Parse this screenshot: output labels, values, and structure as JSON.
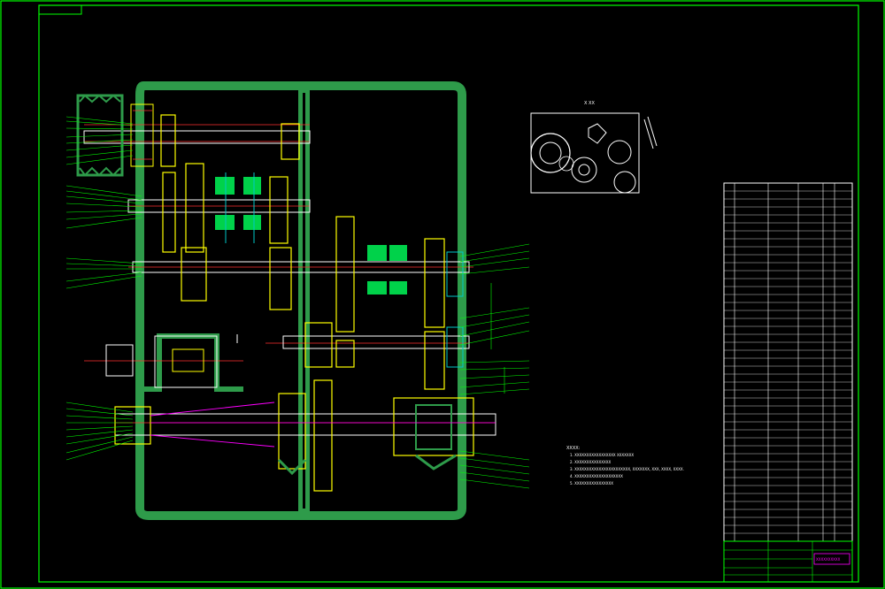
{
  "drawing": {
    "view_label": "X  XX",
    "notes_title": "XXXX:",
    "notes": [
      "1. XXXXXXXXXXXXXXXXX XXXXXXX",
      "2. XXXXXXXXXXXXXXX",
      "3. XXXXXXXXXXXXXXXXXXXXXXX, XXXXXXX, XXX, XXXX, XXXX.",
      "4. XXXXXXXXXXXXXXXXXXXX",
      "5. XXXXXXXXXXXXXXXX"
    ],
    "title_block_name": "XXXXXXXXXX"
  },
  "colors": {
    "background": "#000000",
    "frame": "#00ff00",
    "housing": "#2e9b4a",
    "gear_yellow": "#ffff00",
    "gear_cyan": "#00c8c8",
    "accent_red": "#ff3030",
    "accent_magenta": "#ff00ff",
    "white": "#ffffff",
    "clutch": "#00d24a"
  }
}
